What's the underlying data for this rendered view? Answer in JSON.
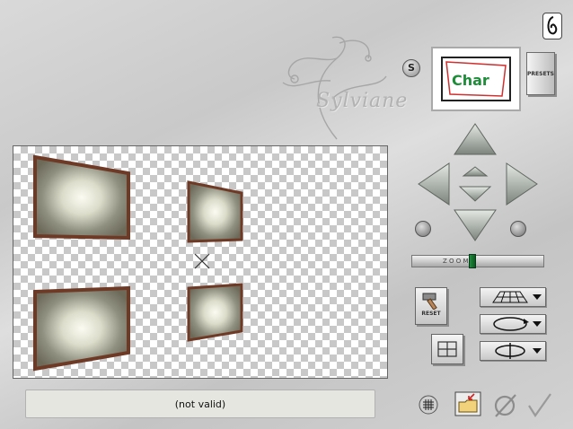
{
  "window": {
    "signature": "Sylviane"
  },
  "preset_panel": {
    "s_label": "S",
    "preview_text": "Char",
    "presets_label": "PRESETS"
  },
  "canvas": {
    "background": "transparent-checkerboard",
    "tile_count": 4,
    "center_marker": "cross"
  },
  "navigation": {
    "up": "arrow-up-icon",
    "down": "arrow-down-icon",
    "left": "arrow-left-icon",
    "right": "arrow-right-icon",
    "center_up": "center-up-icon",
    "center_down": "center-down-icon"
  },
  "zoom": {
    "label": "Z O O M",
    "value": 0.45
  },
  "controls": {
    "reset_label": "RESET",
    "perspective_icon": "perspective-grid-icon",
    "rotate_icon": "rotate-ellipse-icon",
    "flip_icon": "flip-cylinder-icon",
    "fit_icon": "fit-frame-icon"
  },
  "status": {
    "text": "(not valid)"
  },
  "bottom_icons": {
    "grid": "grid-icon",
    "import": "import-folder-icon",
    "cancel": "cancel-icon",
    "ok": "checkmark-icon"
  },
  "colors": {
    "accent_green": "#1f8c3a",
    "metal_light": "#e4e8e4",
    "metal_dark": "#7c847c",
    "frame_brown": "#6e3a26"
  }
}
